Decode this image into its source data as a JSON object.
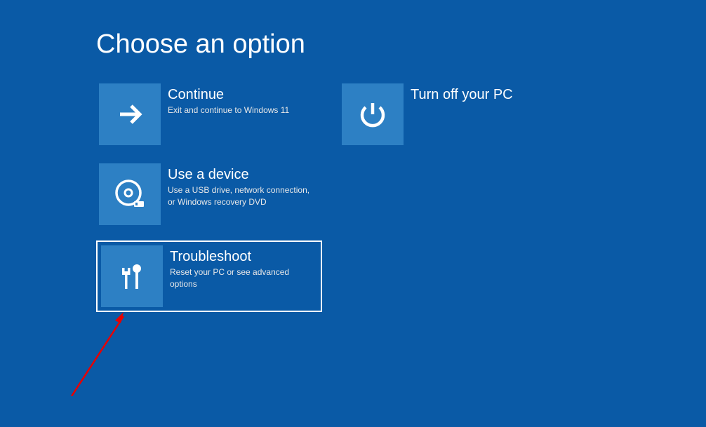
{
  "title": "Choose an option",
  "options": {
    "continue": {
      "title": "Continue",
      "desc": "Exit and continue to Windows 11"
    },
    "use_device": {
      "title": "Use a device",
      "desc": "Use a USB drive, network connection, or Windows recovery DVD"
    },
    "troubleshoot": {
      "title": "Troubleshoot",
      "desc": "Reset your PC or see advanced options"
    },
    "turn_off": {
      "title": "Turn off your PC",
      "desc": ""
    }
  }
}
